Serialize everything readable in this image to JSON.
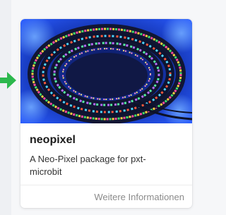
{
  "card": {
    "title": "neopixel",
    "description": "A Neo-Pixel package for pxt-microbit",
    "footer_link": "Weitere Informationen",
    "image_alt": "Rolled-up strip of multicolored NeoPixel LEDs"
  },
  "icons": {
    "pointer": "arrow-right-icon"
  },
  "colors": {
    "arrow": "#2db84d",
    "page_background": "#f6f7f9",
    "card_background": "#ffffff",
    "footer_text": "#8b8b8b"
  }
}
